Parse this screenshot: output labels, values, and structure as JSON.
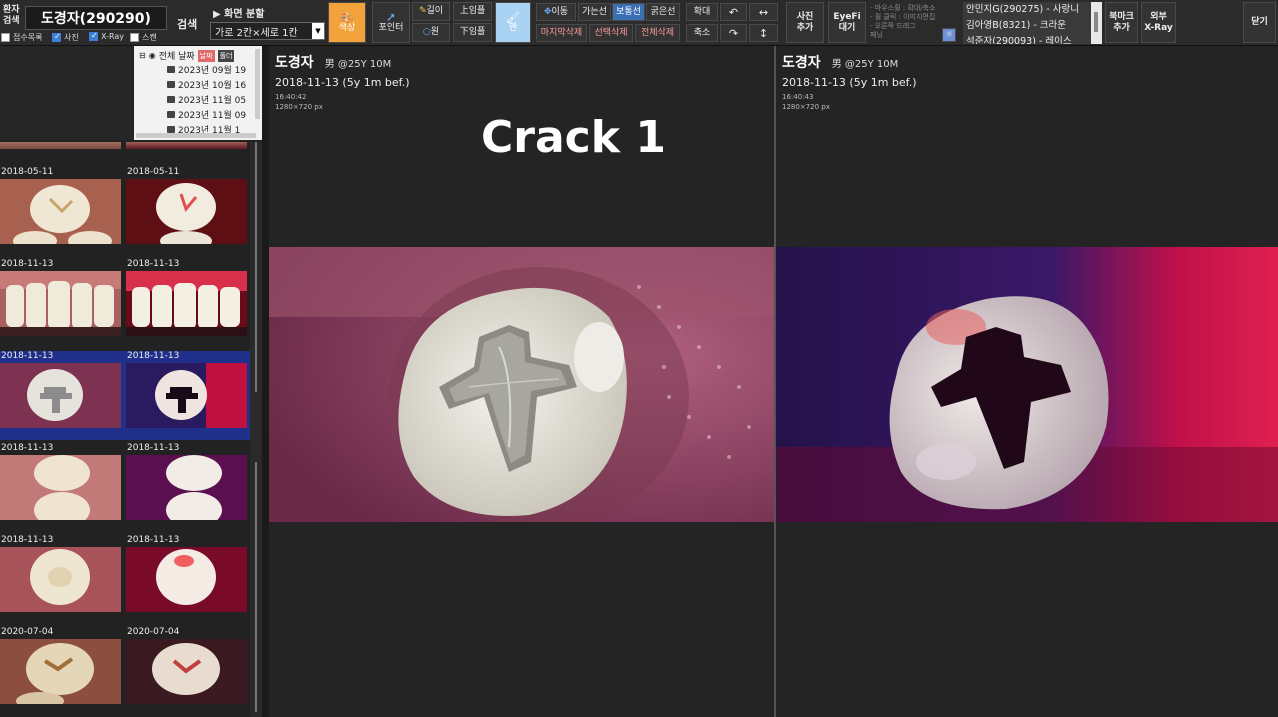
{
  "toolbar": {
    "patient_search_label_1": "환자",
    "patient_search_label_2": "검색",
    "patient_name": "도경자(290290)",
    "search_button": "검색",
    "checkboxes": [
      {
        "label": "접수목록",
        "checked": false
      },
      {
        "label": "사진",
        "checked": true
      },
      {
        "label": "X-Ray",
        "checked": true
      },
      {
        "label": "스캔",
        "checked": false
      }
    ],
    "split_label": "▶ 화면 분할",
    "layout_value": "가로 2칸×세로 1칸",
    "color_button": "색상",
    "pointer_button": "포인터",
    "length_button": "길이",
    "circle_button": "원",
    "upper_button": "上임플",
    "lower_button": "下임플",
    "pen_button": "펜",
    "move_button": "이동",
    "thin_line": "가는선",
    "normal_line": "보통선",
    "thick_line": "굵은선",
    "delete_last": "마지막삭제",
    "delete_selected": "선택삭제",
    "delete_all": "전체삭제",
    "zoom_in": "확대",
    "zoom_out": "축소",
    "rotate_left": "↶",
    "flip_h": "↔",
    "rotate_right": "↷",
    "flip_v": "↕",
    "add_photo_1": "사진",
    "add_photo_2": "추가",
    "eyefi_1": "EyeFi",
    "eyefi_2": "대기",
    "hints": [
      "- 마우스휠 : 확대/축소",
      "- 휠 클릭 : 이미지편집",
      "- 오른쪽 드래그",
      "패닝"
    ],
    "patient_list": [
      "안민지G(290275) - 사랑니",
      "김아영B(8321) - 크라운",
      "석준자(290093) - 레이스"
    ],
    "bookmark_1": "북마크",
    "bookmark_2": "추가",
    "external_xray_1": "외부",
    "external_xray_2": "X-Ray",
    "close_button": "닫기"
  },
  "tree": {
    "root_label": "전체 날짜",
    "tab_date": "날짜",
    "tab_folder": "폴더",
    "nodes": [
      "2023년 09월 19",
      "2023년 10월 16",
      "2023년 11월 05",
      "2023년 11월 09",
      "2023년 11월 1"
    ]
  },
  "thumbnails": [
    {
      "date_left": "2018-05-11",
      "date_right": "2018-05-11"
    },
    {
      "date_left": "2018-11-13",
      "date_right": "2018-11-13"
    },
    {
      "date_left": "2018-11-13",
      "date_right": "2018-11-13"
    },
    {
      "date_left": "2018-11-13",
      "date_right": "2018-11-13"
    },
    {
      "date_left": "2018-11-13",
      "date_right": "2018-11-13"
    },
    {
      "date_left": "2020-07-04",
      "date_right": "2020-07-04"
    }
  ],
  "viewer_left": {
    "name": "도경자",
    "sub": "男 @25Y 10M",
    "date": "2018-11-13 (5y 1m bef.)",
    "time": "16:40:42",
    "size": "1280×720 px"
  },
  "viewer_right": {
    "name": "도경자",
    "sub": "男 @25Y 10M",
    "date": "2018-11-13 (5y 1m bef.)",
    "time": "16:40:43",
    "size": "1280×720 px"
  },
  "caption": "Crack 1",
  "colors": {
    "toolbar_bg": "#2b2b2b",
    "viewer_bg": "#242424",
    "selected_thumb": "#1f2f8a",
    "color_button": "#f2a23b",
    "normal_line_active": "#3b6fb3"
  }
}
